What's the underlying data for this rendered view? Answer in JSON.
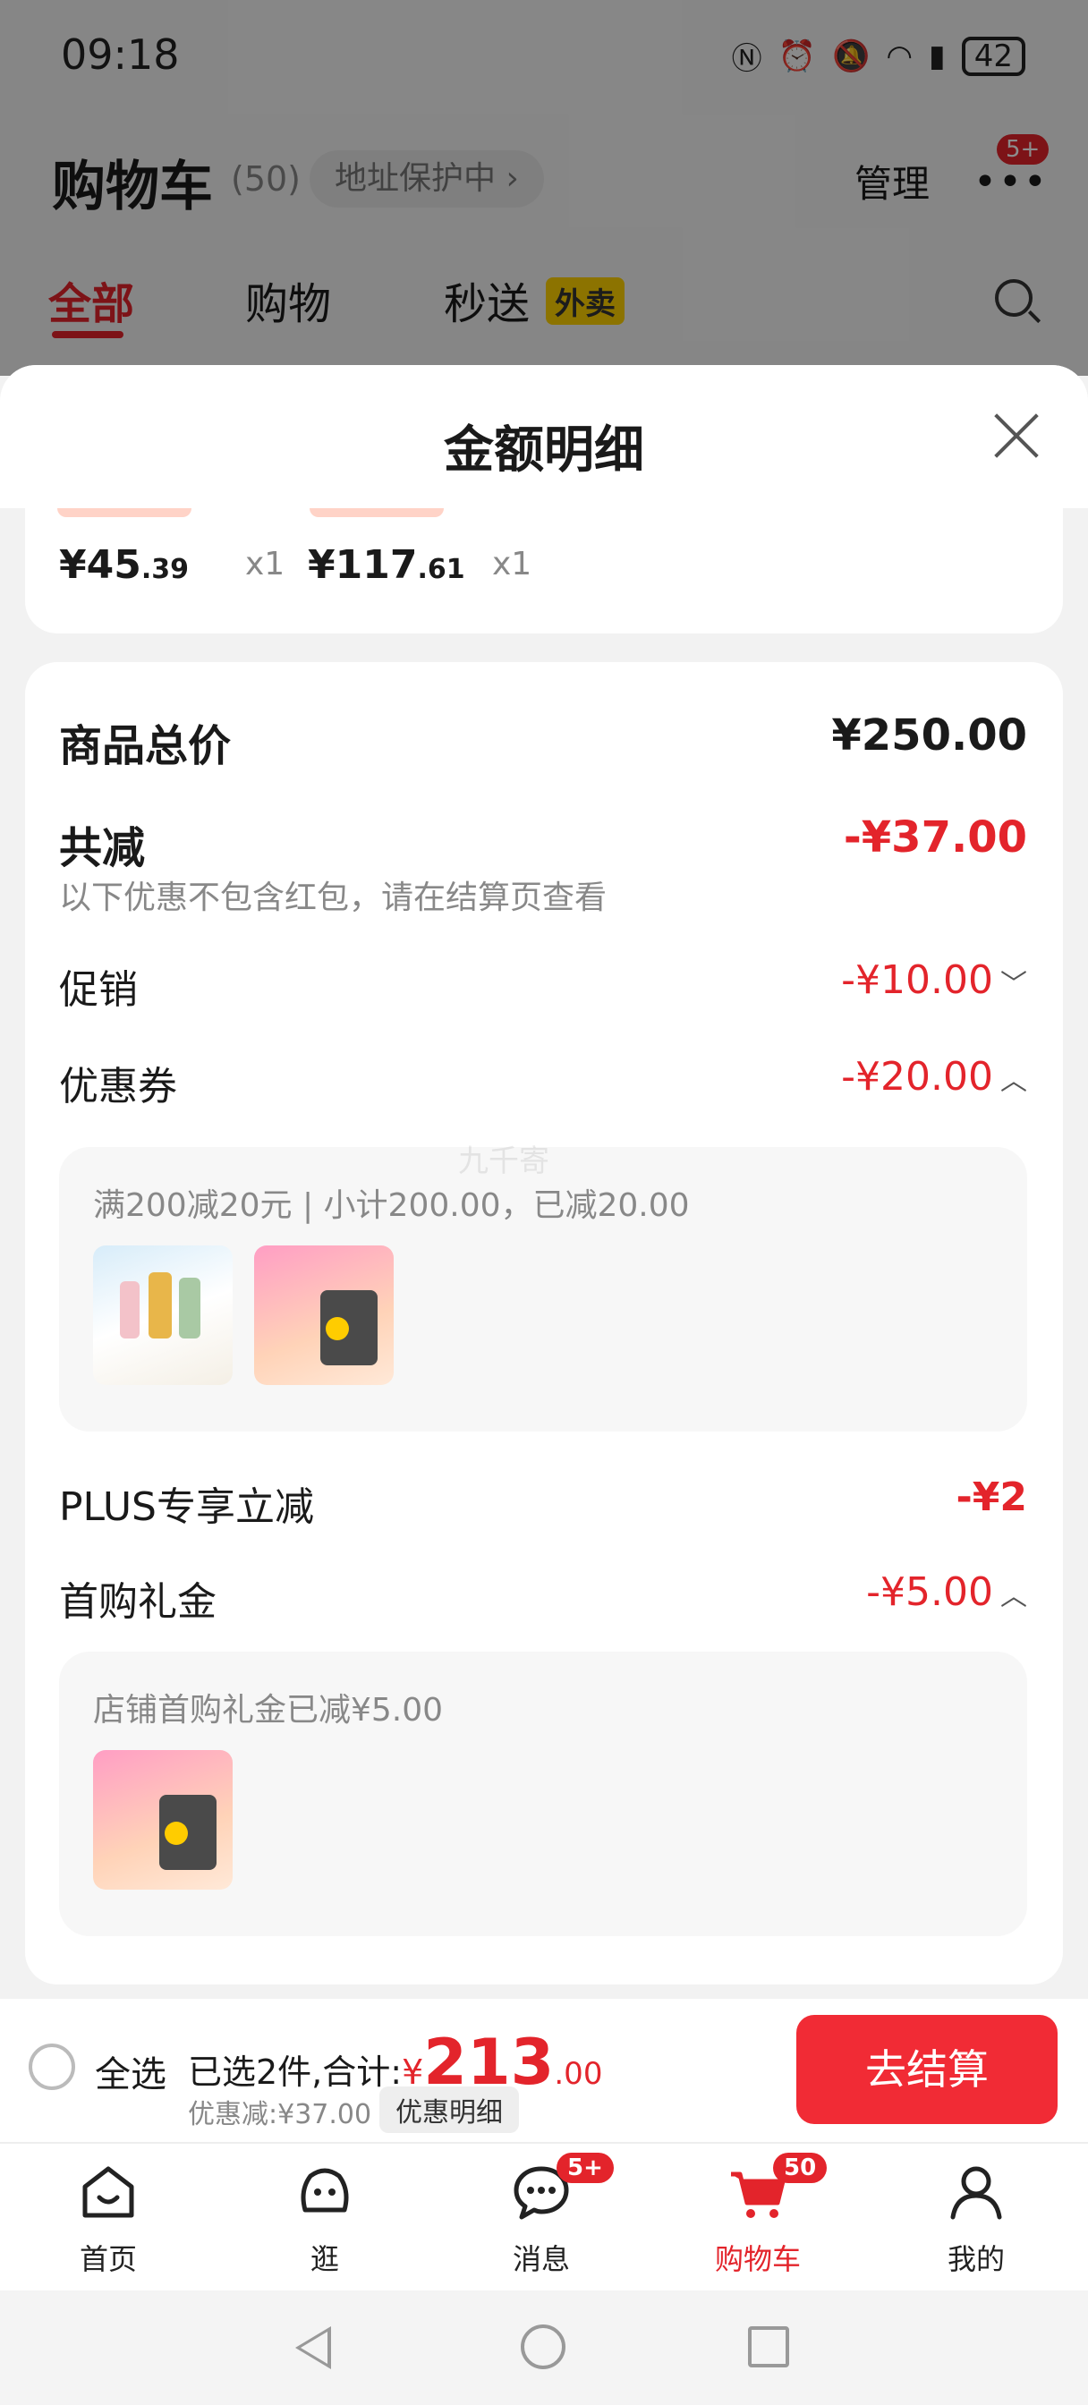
{
  "status_bar": {
    "time": "09:18",
    "battery": "42"
  },
  "header": {
    "title": "购物车",
    "count": "(50)",
    "address_pill": "地址保护中 ›",
    "manage": "管理",
    "more_badge": "5+"
  },
  "tabs": [
    {
      "label": "全部"
    },
    {
      "label": "购物"
    },
    {
      "label": "秒送"
    }
  ],
  "tab_tag": "外卖",
  "sheet": {
    "title": "金额明细",
    "items": [
      {
        "price_int": "¥45",
        "price_dec": ".39",
        "qty": "x1"
      },
      {
        "price_int": "¥117",
        "price_dec": ".61",
        "qty": "x1"
      }
    ],
    "total_label": "商品总价",
    "total_value": "¥250.00",
    "reduce_label": "共减",
    "reduce_value": "-¥37.00",
    "reduce_note": "以下优惠不包含红包，请在结算页查看",
    "promo_label": "促销",
    "promo_value": "-¥10.00",
    "coupon_label": "优惠券",
    "coupon_value": "-¥20.00",
    "coupon_detail": "满200减20元 | 小计200.00，已减20.00",
    "plus_label": "PLUS专享立减",
    "plus_value": "-¥2",
    "gift_label": "首购礼金",
    "gift_value": "-¥5.00",
    "gift_detail": "店铺首购礼金已减¥5.00",
    "watermark": "九千寄"
  },
  "checkout": {
    "select_all": "全选",
    "selected_text": "已选2件,合计:",
    "currency": "¥",
    "total_int": "213",
    "total_dec": ".00",
    "discount_text": "优惠减:¥37.00",
    "detail_button": "优惠明细",
    "checkout_button": "去结算"
  },
  "bottom_nav": [
    {
      "label": "首页"
    },
    {
      "label": "逛"
    },
    {
      "label": "消息",
      "badge": "5+"
    },
    {
      "label": "购物车",
      "badge": "50"
    },
    {
      "label": "我的"
    }
  ],
  "colors": {
    "accent": "#e3242b",
    "button": "#f12b35",
    "tag": "#ffd200"
  }
}
